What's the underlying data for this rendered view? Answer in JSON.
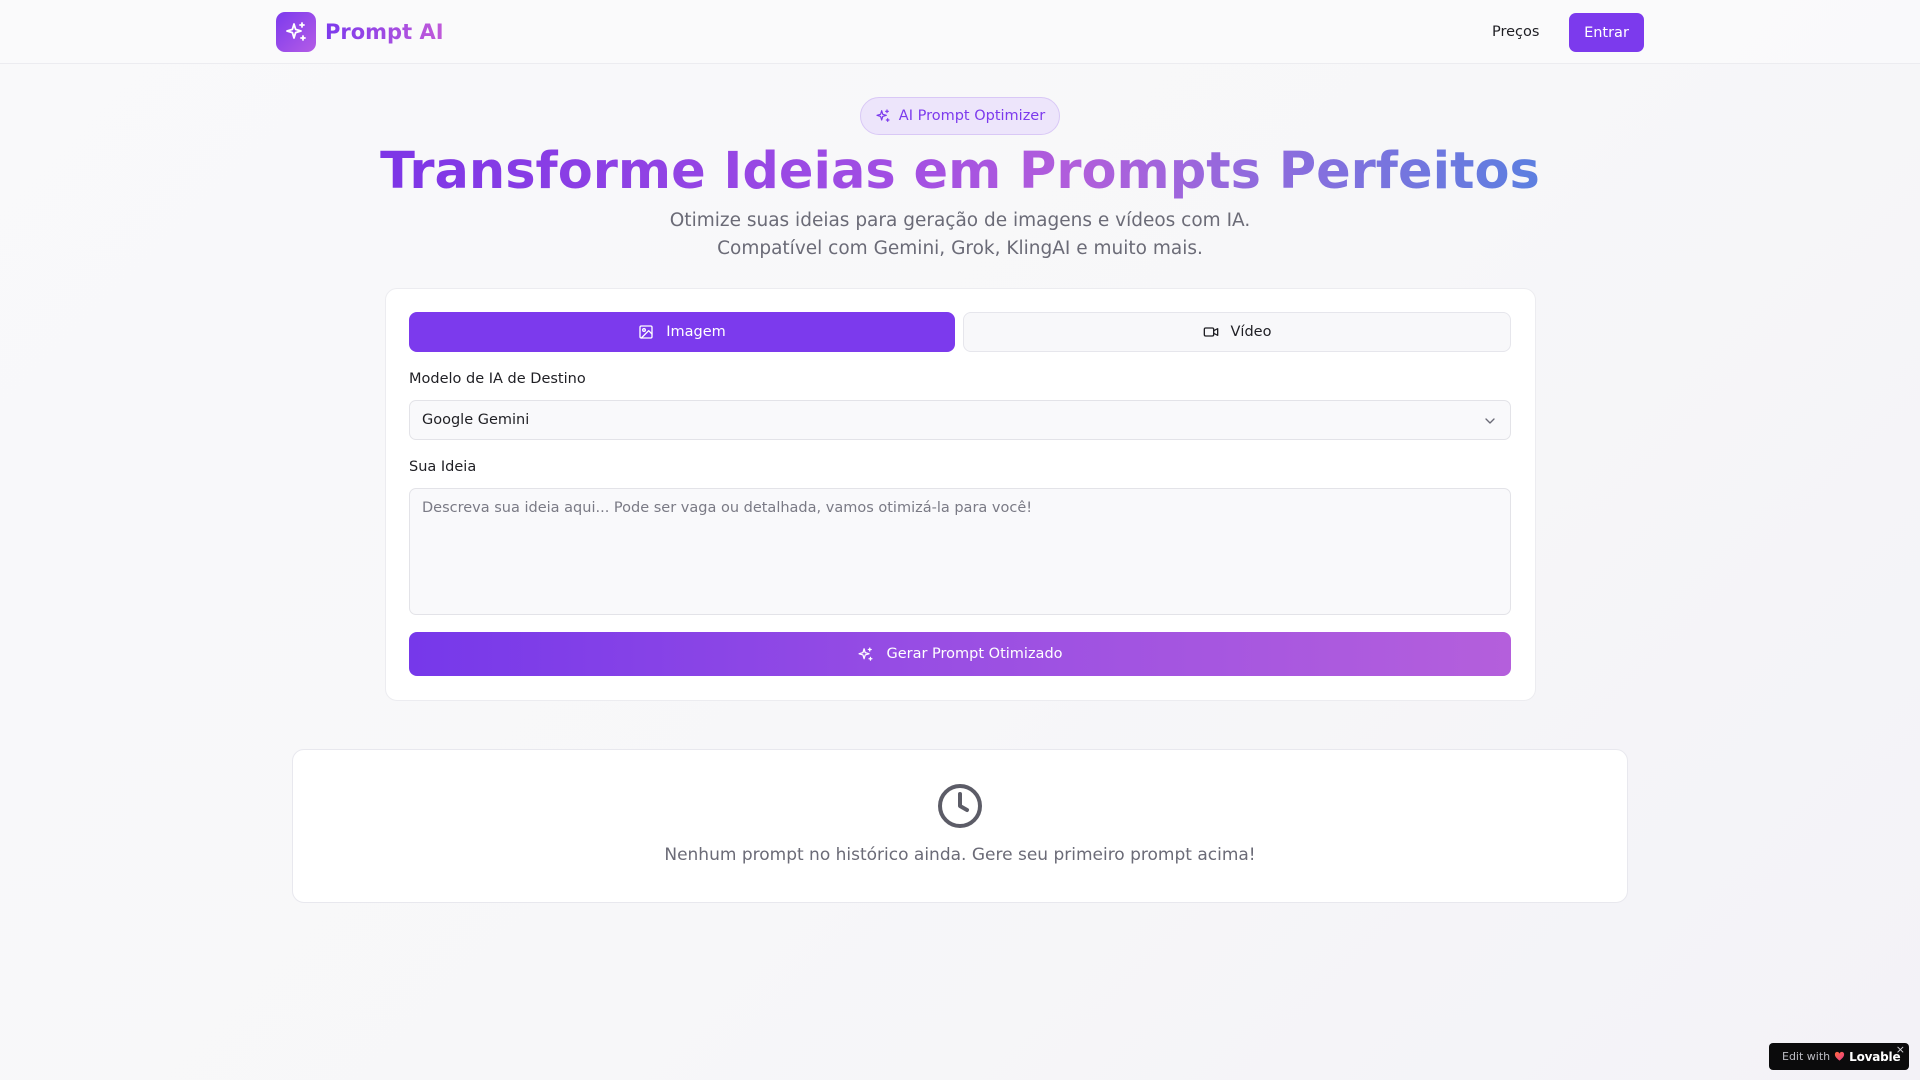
{
  "header": {
    "brand_name": "Prompt AI",
    "brand_icon": "sparkles-icon",
    "nav_pricing": "Preços",
    "login_label": "Entrar"
  },
  "hero": {
    "badge_label": "AI Prompt Optimizer",
    "title": "Transforme Ideias em Prompts Perfeitos",
    "subtitle_line1": "Otimize suas ideias para geração de imagens e vídeos com IA.",
    "subtitle_line2": "Compatível com Gemini, Grok, KlingAI e muito mais."
  },
  "form": {
    "tabs": [
      {
        "label": "Imagem",
        "icon": "image-icon",
        "active": true
      },
      {
        "label": "Vídeo",
        "icon": "video-icon",
        "active": false
      }
    ],
    "model_label": "Modelo de IA de Destino",
    "model_selected": "Google Gemini",
    "idea_label": "Sua Ideia",
    "idea_value": "",
    "idea_placeholder": "Descreva sua ideia aqui... Pode ser vaga ou detalhada, vamos otimizá-la para você!",
    "generate_label": "Gerar Prompt Otimizado"
  },
  "history": {
    "icon": "clock-icon",
    "empty_message": "Nenhum prompt no histórico ainda. Gere seu primeiro prompt acima!"
  },
  "badge": {
    "edit_with": "Edit with",
    "brand": "Lovable",
    "close": "×"
  },
  "colors": {
    "primary": "#7c3aed",
    "accent_pink": "#b45fdc",
    "muted_text": "#6b6b77"
  }
}
